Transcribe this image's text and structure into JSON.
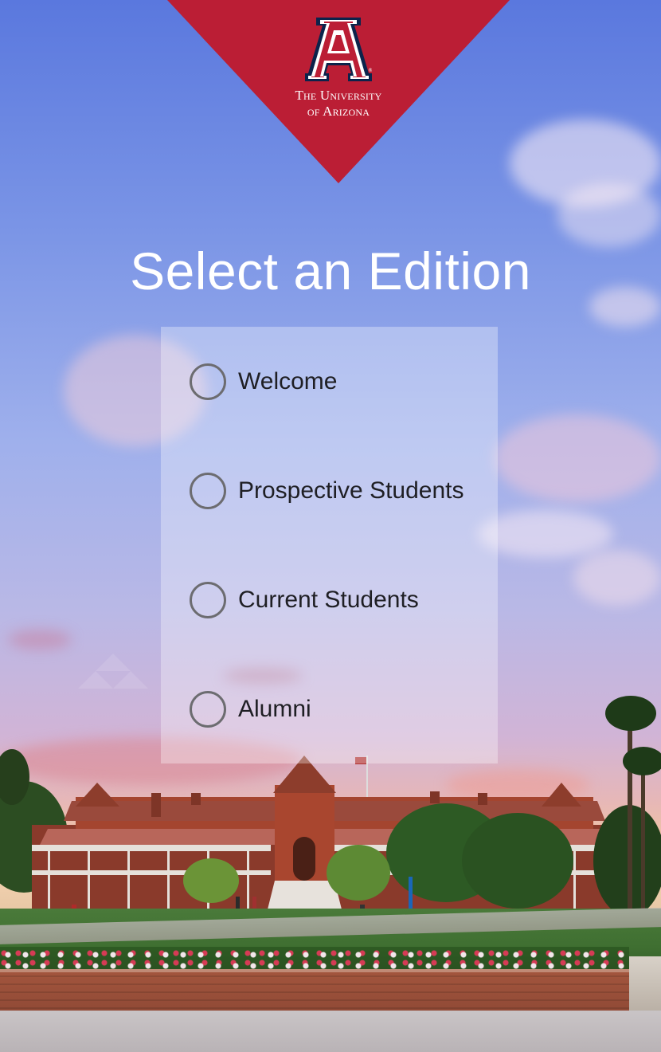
{
  "logo": {
    "letter": "A",
    "line1": "The University",
    "line2": "of Arizona",
    "brand_red": "#bb1e35",
    "brand_navy": "#0c234b"
  },
  "title": "Select an Edition",
  "options": [
    {
      "label": "Welcome",
      "selected": false
    },
    {
      "label": "Prospective Students",
      "selected": false
    },
    {
      "label": "Current Students",
      "selected": false
    },
    {
      "label": "Alumni",
      "selected": false
    }
  ]
}
